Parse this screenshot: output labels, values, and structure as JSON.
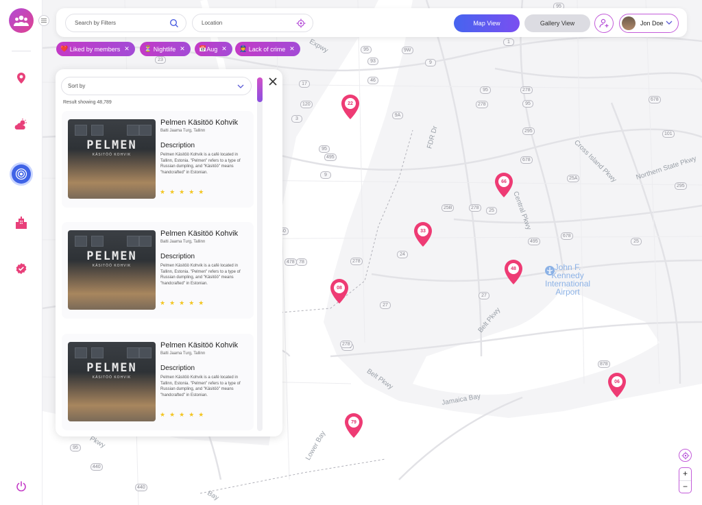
{
  "search": {
    "placeholder": "Search by Filters"
  },
  "location": {
    "placeholder": "Location"
  },
  "views": {
    "map": "Map View",
    "gallery": "Gallery View"
  },
  "user": {
    "name": "Jon Doe"
  },
  "filters": [
    {
      "label": "Liked by members",
      "emoji": "❤️"
    },
    {
      "label": "Nightlife",
      "emoji": "⏳"
    },
    {
      "label": "Aug",
      "emoji": "📅"
    },
    {
      "label": "Lack of crime",
      "emoji": "👮"
    }
  ],
  "panel": {
    "sort_label": "Sort by",
    "result_count": "Result showing 48,789",
    "cards": [
      {
        "title": "Pelmen Käsitöö Kohvik",
        "address": "Balti Jaama Turg, Tallinn",
        "desc_heading": "Description",
        "desc": "Pelmen Käsitöö Kohvik is a café located in Tallinn, Estonia. \"Pelmen\" refers to a type of Russian dumpling, and \"Käsitöö\" means \"handcrafted\" in Estonian.",
        "stars": "★★★★★",
        "image_sign": "PELMEN",
        "image_subsign": "KÄSITÖÖ KOHVIK"
      },
      {
        "title": "Pelmen Käsitöö Kohvik",
        "address": "Balti Jaama Turg, Tallinn",
        "desc_heading": "Description",
        "desc": "Pelmen Käsitöö Kohvik is a café located in Tallinn, Estonia. \"Pelmen\" refers to a type of Russian dumpling, and \"Käsitöö\" means \"handcrafted\" in Estonian.",
        "stars": "★★★★★",
        "image_sign": "PELMEN",
        "image_subsign": "KÄSITÖÖ KOHVIK"
      },
      {
        "title": "Pelmen Käsitöö Kohvik",
        "address": "Balti Jaama Turg, Tallinn",
        "desc_heading": "Description",
        "desc": "Pelmen Käsitöö Kohvik is a café located in Tallinn, Estonia. \"Pelmen\" refers to a type of Russian dumpling, and \"Käsitöö\" means \"handcrafted\" in Estonian.",
        "stars": "★★★★★",
        "image_sign": "PELMEN",
        "image_subsign": "KÄSITÖÖ KOHVIK"
      }
    ]
  },
  "map": {
    "pins": [
      "22",
      "66",
      "33",
      "48",
      "08",
      "06",
      "79"
    ],
    "labels": {
      "fdr": "FDR Dr",
      "cross_island": "Cross Island Pkwy",
      "northern_state": "Northern State Pkwy",
      "central": "Central Pkwy",
      "belt_pkwy": "Belt Pkwy",
      "belt_pkwy2": "Belt Pkwy",
      "jamaica": "Jamaica Bay",
      "lower_bay": "Lower Bay",
      "expwy": "Expwy",
      "bay": "Bay",
      "pkwy": "Pkwy"
    },
    "airport": [
      "John F.",
      "Kennedy",
      "International",
      "Airport"
    ],
    "route_numbers": [
      "23",
      "95",
      "93",
      "46",
      "17",
      "120",
      "3",
      "95",
      "495",
      "9",
      "9A",
      "278",
      "95",
      "278",
      "95",
      "295",
      "678",
      "678",
      "101",
      "25A",
      "295",
      "25B",
      "278",
      "25",
      "495",
      "678",
      "25",
      "24",
      "278",
      "478",
      "27",
      "27",
      "278",
      "278",
      "878",
      "440",
      "95",
      "40",
      "78",
      "9W",
      "1",
      "95",
      "9",
      "440"
    ]
  },
  "accent": {
    "primary": "#4664ef",
    "magenta": "#c33ac6",
    "pin": "#ee3b74",
    "star": "#f3c623"
  }
}
